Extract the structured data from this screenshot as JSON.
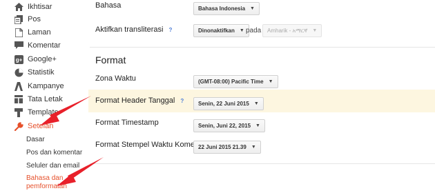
{
  "sidebar": {
    "items": [
      {
        "label": "Ikhtisar",
        "icon": "home-icon"
      },
      {
        "label": "Pos",
        "icon": "posts-icon"
      },
      {
        "label": "Laman",
        "icon": "pages-icon"
      },
      {
        "label": "Komentar",
        "icon": "comment-icon"
      },
      {
        "label": "Google+",
        "icon": "google-plus-icon"
      },
      {
        "label": "Statistik",
        "icon": "stats-icon"
      },
      {
        "label": "Kampanye",
        "icon": "campaign-icon"
      },
      {
        "label": "Tata Letak",
        "icon": "layout-icon"
      },
      {
        "label": "Template",
        "icon": "template-icon"
      },
      {
        "label": "Setelan",
        "icon": "wrench-icon"
      }
    ],
    "subitems": [
      "Dasar",
      "Pos dan komentar",
      "Seluler dan email",
      "Bahasa dan",
      "pemformatan"
    ]
  },
  "main": {
    "bahasa_label": "Bahasa",
    "bahasa_value": "Bahasa Indonesia",
    "translit_label": "Aktifkan transliterasi",
    "translit_help": "?",
    "translit_value": "Dinonaktifkan",
    "pada": "pada",
    "translit_lang": "Amharik - አማርኛ",
    "format_title": "Format",
    "zona_label": "Zona Waktu",
    "zona_value": "(GMT-08:00) Pacific Time",
    "header_label": "Format Header Tanggal",
    "header_help": "?",
    "header_value": "Senin, 22 Juni 2015",
    "timestamp_label": "Format Timestamp",
    "timestamp_value": "Senin, Juni 22, 2015",
    "stempel_label": "Format Stempel Waktu Komentar",
    "stempel_value": "22 Juni 2015 21.39"
  },
  "colors": {
    "accent": "#e6502b",
    "highlight": "#fdf6e0",
    "arrow": "#e8202a"
  }
}
